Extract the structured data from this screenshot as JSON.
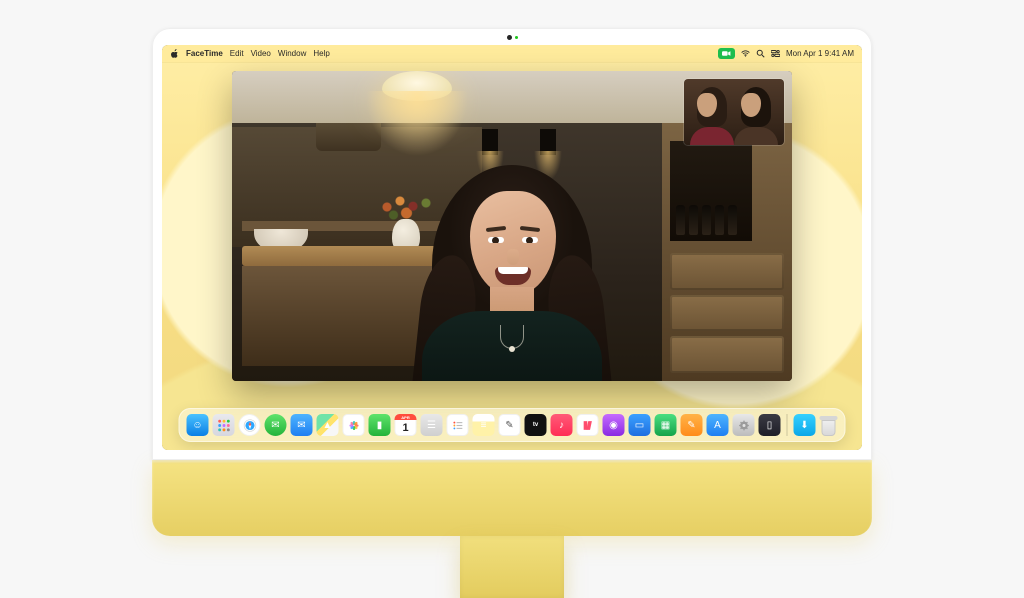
{
  "menubar": {
    "app": "FaceTime",
    "items": [
      "Edit",
      "Video",
      "Window",
      "Help"
    ],
    "right": {
      "facetime_pill": "⎚",
      "datetime": "Mon Apr 1  9:41 AM"
    }
  },
  "dock": {
    "apps": [
      {
        "n": "finder",
        "bg": "linear-gradient(#4ac2ff,#0a7fe5)",
        "glyph": "☺"
      },
      {
        "n": "launchpad",
        "bg": "linear-gradient(#e9e9ee,#d7d7de)",
        "grid": true
      },
      {
        "n": "safari",
        "bg": "#fff",
        "compass": true,
        "circle": true
      },
      {
        "n": "messages",
        "bg": "linear-gradient(#5fe36b,#24b33a)",
        "glyph": "✉",
        "circle": true
      },
      {
        "n": "mail",
        "bg": "linear-gradient(#4db4ff,#1f7ff2)",
        "glyph": "✉"
      },
      {
        "n": "maps",
        "bg": "linear-gradient(135deg,#6fe3a8 0 40%,#ffe36b 40% 60%,#f7f7f7 60%)",
        "glyph": "▲"
      },
      {
        "n": "photos",
        "bg": "#fff",
        "flower": true
      },
      {
        "n": "facetime",
        "bg": "linear-gradient(#5fe36b,#24b33a)",
        "glyph": "▮"
      },
      {
        "n": "calendar",
        "bg": "#fff",
        "cal": "1",
        "caltop": "APR"
      },
      {
        "n": "contacts",
        "bg": "linear-gradient(#e8e8e8,#cfcfcf)",
        "glyph": "☰"
      },
      {
        "n": "reminders",
        "bg": "#fff",
        "lines": true
      },
      {
        "n": "notes",
        "bg": "linear-gradient(#fff 35%,#fff2a8 35%)",
        "glyph": "≡"
      },
      {
        "n": "freeform",
        "bg": "#fff",
        "glyph": "✎"
      },
      {
        "n": "tv",
        "bg": "#111",
        "glyph": "tv",
        "txt": true
      },
      {
        "n": "music",
        "bg": "linear-gradient(#ff5a78,#ff2d55)",
        "glyph": "♪"
      },
      {
        "n": "news",
        "bg": "#fff",
        "news": true
      },
      {
        "n": "podcasts",
        "bg": "linear-gradient(#c56bff,#8a2be2)",
        "glyph": "◉",
        "circle": false
      },
      {
        "n": "keynote",
        "bg": "linear-gradient(#3aa0ff,#1f6fe0)",
        "glyph": "▭"
      },
      {
        "n": "numbers",
        "bg": "linear-gradient(#4ade80,#16a34a)",
        "glyph": "▦"
      },
      {
        "n": "pages",
        "bg": "linear-gradient(#ffb347,#ff8c1a)",
        "glyph": "✎"
      },
      {
        "n": "appstore",
        "bg": "linear-gradient(#4db4ff,#1f7ff2)",
        "glyph": "A"
      },
      {
        "n": "settings",
        "bg": "linear-gradient(#e8e8e8,#bcbcbc)",
        "gear": true
      },
      {
        "n": "iphone-mirror",
        "bg": "linear-gradient(#3a3a44,#1f1f27)",
        "glyph": "▯"
      }
    ],
    "right": [
      {
        "n": "downloads",
        "bg": "linear-gradient(#36d1ff,#0aa7e8)",
        "glyph": "⬇"
      }
    ]
  }
}
